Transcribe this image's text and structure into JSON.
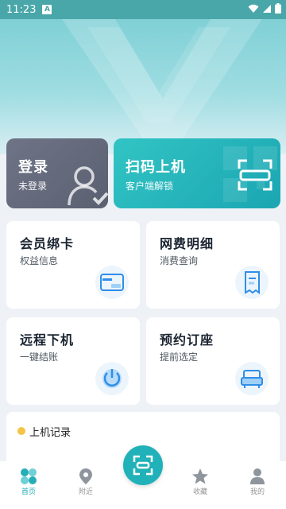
{
  "status_bar": {
    "time": "11:23",
    "notification_letter": "A"
  },
  "top_cards": {
    "login": {
      "title": "登录",
      "subtitle": "未登录"
    },
    "scan": {
      "title": "扫码上机",
      "subtitle": "客户端解锁"
    }
  },
  "grid": [
    {
      "title": "会员绑卡",
      "subtitle": "权益信息",
      "icon": "card-icon"
    },
    {
      "title": "网费明细",
      "subtitle": "消费查询",
      "icon": "receipt-icon"
    },
    {
      "title": "远程下机",
      "subtitle": "一键结账",
      "icon": "power-icon"
    },
    {
      "title": "预约订座",
      "subtitle": "提前选定",
      "icon": "seat-icon"
    }
  ],
  "record": {
    "label": "上机记录"
  },
  "tabbar": {
    "tabs": [
      {
        "label": "首页",
        "icon": "home-grid-icon",
        "active": true
      },
      {
        "label": "附近",
        "icon": "location-pin-icon",
        "active": false
      },
      {
        "label": "收藏",
        "icon": "star-icon",
        "active": false
      },
      {
        "label": "我的",
        "icon": "user-icon",
        "active": false
      }
    ],
    "center_icon": "scan-icon"
  },
  "colors": {
    "accent": "#21b1b9",
    "login_card": "#60667a",
    "scan_card": "#25b5bd"
  }
}
